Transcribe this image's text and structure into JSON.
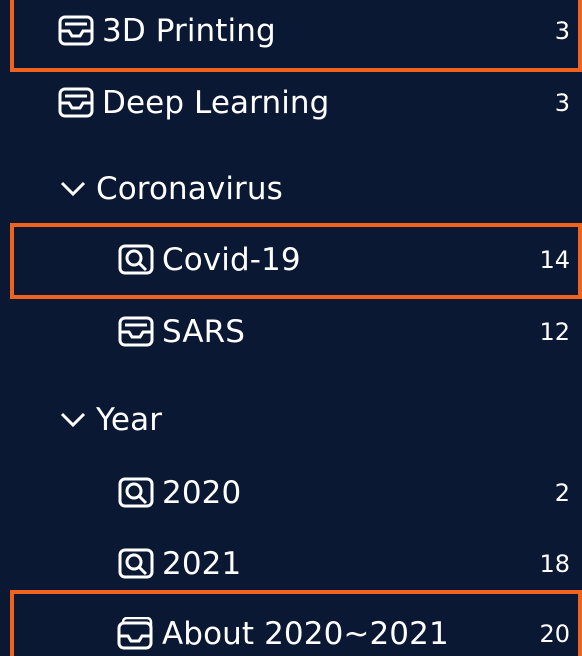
{
  "colors": {
    "background": "#0b1833",
    "text": "#ffffff",
    "highlight": "#f0631f"
  },
  "tree": {
    "items": [
      {
        "label": "3D Printing",
        "count": "3",
        "icon": "inbox-icon"
      },
      {
        "label": "Deep Learning",
        "count": "3",
        "icon": "inbox-icon"
      },
      {
        "label": "Coronavirus",
        "count": "",
        "icon": "chevron-down-icon"
      },
      {
        "label": "Covid-19",
        "count": "14",
        "icon": "search-folder-icon"
      },
      {
        "label": "SARS",
        "count": "12",
        "icon": "inbox-icon"
      },
      {
        "label": "Year",
        "count": "",
        "icon": "chevron-down-icon"
      },
      {
        "label": "2020",
        "count": "2",
        "icon": "search-folder-icon"
      },
      {
        "label": "2021",
        "count": "18",
        "icon": "search-folder-icon"
      },
      {
        "label": "About 2020~2021",
        "count": "20",
        "icon": "stacked-inbox-icon"
      }
    ]
  }
}
